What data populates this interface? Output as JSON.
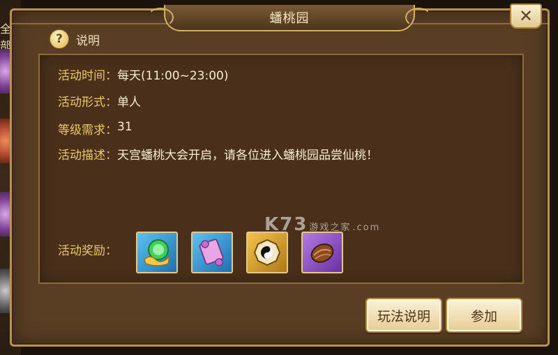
{
  "background": {
    "partial_text": "全部"
  },
  "dialog": {
    "title": "蟠桃园",
    "close_symbol": "✕",
    "help": {
      "icon": "?",
      "label": "说明"
    },
    "info": [
      {
        "label": "活动时间：",
        "value": "每天(11:00~23:00)"
      },
      {
        "label": "活动形式：",
        "value": "单人"
      },
      {
        "label": "等级需求：",
        "value": "31"
      },
      {
        "label": "活动描述：",
        "value": "天宫蟠桃大会开启，请各位进入蟠桃园品尝仙桃！"
      }
    ],
    "rewards_label": "活动奖励：",
    "rewards": [
      {
        "icon": "green-gem-ingot-icon",
        "frame_color": "#2f8fd6"
      },
      {
        "icon": "pink-scroll-icon",
        "frame_color": "#2f8fd6"
      },
      {
        "icon": "bagua-taiji-icon",
        "frame_color": "#d79a22"
      },
      {
        "icon": "peach-seed-icon",
        "frame_color": "#8a4cc4"
      }
    ],
    "buttons": {
      "rules": "玩法说明",
      "join": "参加"
    }
  },
  "watermark": {
    "brand": "K73",
    "tagline": "游戏之家",
    "domain": ".com"
  },
  "colors": {
    "label": "#e9c96a",
    "value": "#f7ecd3",
    "panel": "#4a301a",
    "frame": "#b8934e"
  }
}
